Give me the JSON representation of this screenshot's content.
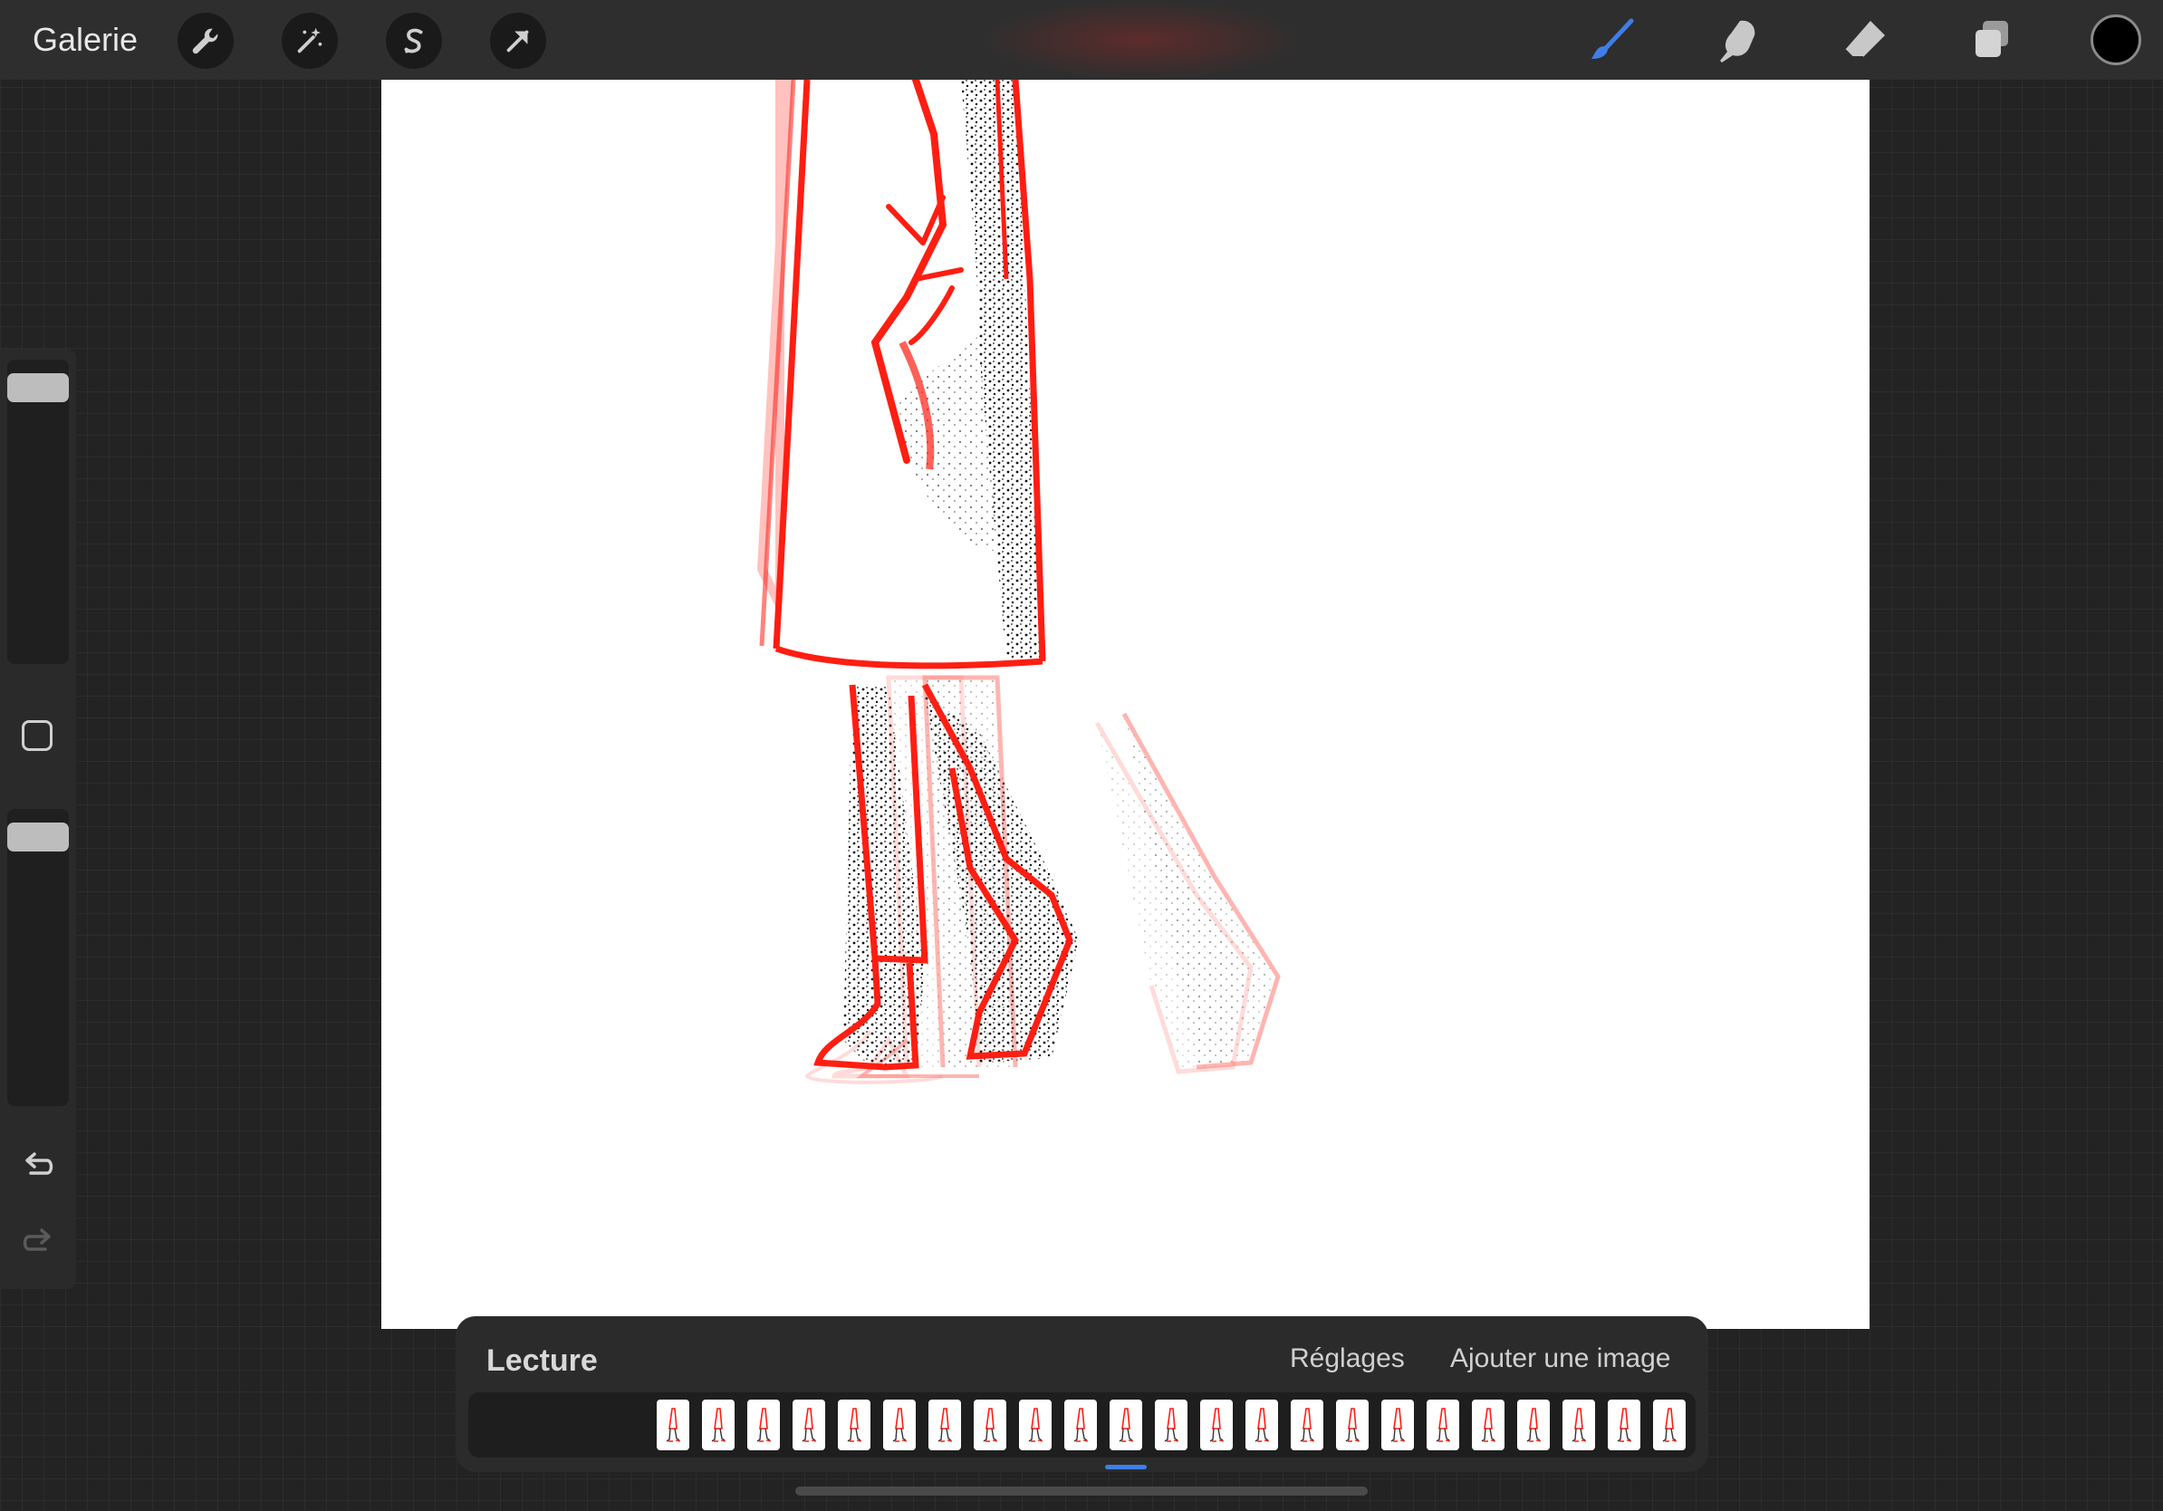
{
  "toolbar": {
    "gallery_label": "Galerie",
    "left_tools": [
      {
        "name": "actions",
        "icon": "wrench-icon"
      },
      {
        "name": "adjustments",
        "icon": "magic-wand-icon"
      },
      {
        "name": "selection",
        "icon": "selection-s-icon"
      },
      {
        "name": "transform",
        "icon": "arrow-cursor-icon"
      }
    ],
    "right_tools": [
      {
        "name": "brush",
        "icon": "brush-icon",
        "active": true
      },
      {
        "name": "smudge",
        "icon": "smudge-finger-icon"
      },
      {
        "name": "eraser",
        "icon": "eraser-icon"
      },
      {
        "name": "layers",
        "icon": "layers-icon"
      }
    ],
    "current_color": "#000000",
    "active_color": "#3f7ee8"
  },
  "sidebar": {
    "brush_size": 0.05,
    "opacity": 0.05,
    "modifier_icon": "square-modifier-icon",
    "undo_icon": "undo-arrow-icon",
    "redo_icon": "redo-arrow-icon"
  },
  "animation_panel": {
    "title": "Lecture",
    "settings_label": "Réglages",
    "add_frame_label": "Ajouter une image",
    "frame_count": 23,
    "selected_frame": 10
  },
  "colors": {
    "stroke_red": "#ff1e12",
    "onion_red": "#ff9a94",
    "stipple": "#111111"
  }
}
